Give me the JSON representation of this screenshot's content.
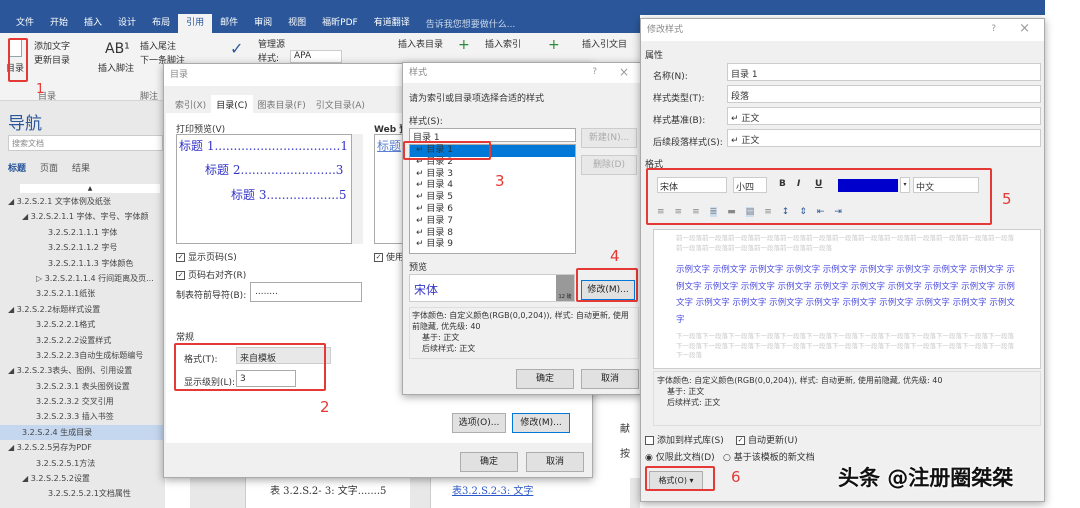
{
  "ribbon": {
    "tabs": [
      "文件",
      "开始",
      "插入",
      "设计",
      "布局",
      "引用",
      "邮件",
      "审阅",
      "视图",
      "福昕PDF",
      "有道翻译"
    ],
    "active_tab": "引用",
    "tell_me": "告诉我您想要做什么...",
    "toc_button": "目录",
    "add_text": "添加文字",
    "update_toc": "更新目录",
    "insert_footnote": "插入脚注",
    "insert_endnote": "插入尾注",
    "next_footnote": "下一条脚注",
    "manage_sources": "管理源",
    "style_label": "样式:",
    "style_value": "APA",
    "insert_table_of_figures": "插入表目录",
    "insert_index": "插入索引",
    "insert_toa": "插入引文目",
    "group_toc": "目录",
    "group_footnotes": "脚注"
  },
  "nav": {
    "title": "导航",
    "search_placeholder": "搜索文档",
    "tabs": [
      "标题",
      "页面",
      "结果"
    ],
    "items": [
      "◢ 3.2.S.2.1 文字体例及纸张",
      "◢ 3.2.S.2.1.1 字体、字号、字体颜",
      "3.2.S.2.1.1.1 字体",
      "3.2.S.2.1.1.2 字号",
      "3.2.S.2.1.1.3 字体颜色",
      "▷ 3.2.S.2.1.1.4 行间距离及页...",
      "3.2.S.2.1.1纸张",
      "◢ 3.2.S.2.2标题样式设置",
      "3.2.S.2.2.1格式",
      "3.2.S.2.2.2设置样式",
      "3.2.S.2.2.3自动生成标题编号",
      "◢ 3.2.S.2.3表头、图例、引用设置",
      "3.2.S.2.3.1 表头图例设置",
      "3.2.S.2.3.2 交叉引用",
      "3.2.S.2.3.3 插入书签",
      "3.2.S.2.4 生成目录",
      "◢ 3.2.S.2.5另存为PDF",
      "3.2.S.2.5.1方法",
      "◢ 3.2.S.2.5.2设置",
      "3.2.S.2.5.2.1文档属性"
    ],
    "selected": "3.2.S.2.4 生成目录"
  },
  "toc_dialog": {
    "title": "目录",
    "tabs": [
      "索引(X)",
      "目录(C)",
      "图表目录(F)",
      "引文目录(A)"
    ],
    "print_preview_label": "打印预览(V)",
    "web_preview_label": "Web 预览",
    "preview_lines": [
      "标题 1.................................1",
      "标题 2.........................3",
      "标题 3...................5"
    ],
    "web_preview_text": "标题",
    "show_page_numbers": "显示页码(S)",
    "right_align": "页码右对齐(R)",
    "use_hyperlinks": "使用",
    "tab_leader_label": "制表符前导符(B):",
    "tab_leader_value": "........",
    "general": "常规",
    "formats_label": "格式(T):",
    "formats_value": "来自模板",
    "levels_label": "显示级别(L):",
    "levels_value": "3",
    "options": "选项(O)...",
    "modify": "修改(M)...",
    "ok": "确定",
    "cancel": "取消"
  },
  "style_dialog": {
    "title": "样式",
    "help": "?",
    "close": "×",
    "prompt": "请为索引或目录项选择合适的样式",
    "styles_label": "样式(S):",
    "current": "目录 1",
    "list": [
      "目录 1",
      "目录 2",
      "目录 3",
      "目录 4",
      "目录 5",
      "目录 6",
      "目录 7",
      "目录 8",
      "目录 9"
    ],
    "new": "新建(N)...",
    "delete": "删除(D)",
    "preview_label": "预览",
    "preview_font": "宋体",
    "preview_size": "12 磅",
    "modify": "修改(M)...",
    "description": "字体颜色: 自定义颜色(RGB(0,0,204)), 样式: 自动更新, 使用前隐藏, 优先级: 40",
    "based_on": "基于: 正文",
    "following": "后续样式: 正文",
    "ok": "确定",
    "cancel": "取消"
  },
  "modify_dialog": {
    "title": "修改样式",
    "help": "?",
    "close": "×",
    "properties": "属性",
    "name_label": "名称(N):",
    "name_value": "目录 1",
    "type_label": "样式类型(T):",
    "type_value": "段落",
    "based_label": "样式基准(B):",
    "based_value": "↵ 正文",
    "next_label": "后续段落样式(S):",
    "next_value": "↵ 正文",
    "format": "格式",
    "font": "宋体",
    "size": "小四",
    "bold": "B",
    "italic": "I",
    "underline": "U",
    "font_color": "#0000cc",
    "script": "中文",
    "before_text": "前一段落前一段落前一段落前一段落前一段落前一段落前一段落前一段落前一段落前一段落前一段落前一段落前一段落前一段落前一段落前一段落前一段落前一段落前一段落",
    "sample_text": "示例文字 示例文字 示例文字 示例文字 示例文字 示例文字 示例文字 示例文字 示例文字 示例文字 示例文字 示例文字 示例文字 示例文字 示例文字 示例文字 示例文字 示例文字 示例文字 示例文字 示例文字 示例文字 示例文字 示例文字 示例文字 示例文字 示例文字 示例文字",
    "after_text": "下一段落下一段落下一段落下一段落下一段落下一段落下一段落下一段落下一段落下一段落下一段落下一段落下一段落下一段落下一段落下一段落下一段落下一段落下一段落下一段落下一段落下一段落下一段落下一段落下一段落下一段落下一段落",
    "description": "字体颜色: 自定义颜色(RGB(0,0,204)), 样式: 自动更新, 使用前隐藏, 优先级: 40",
    "based_on": "基于: 正文",
    "following": "后续样式: 正文",
    "add_gallery": "添加到样式库(S)",
    "auto_update": "自动更新(U)",
    "only_doc": "仅限此文档(D)",
    "new_docs": "基于该模板的新文档",
    "format_button": "格式(O) ▾"
  },
  "document": {
    "line": "表 3.2.S.2- 3: 文字.......5",
    "link": "表3.2.S.2-3: 文字",
    "side1": "献",
    "side2": "按"
  },
  "annotations": [
    "1",
    "2",
    "3",
    "4",
    "5",
    "6"
  ],
  "watermark": "头条 @注册圈桀桀"
}
